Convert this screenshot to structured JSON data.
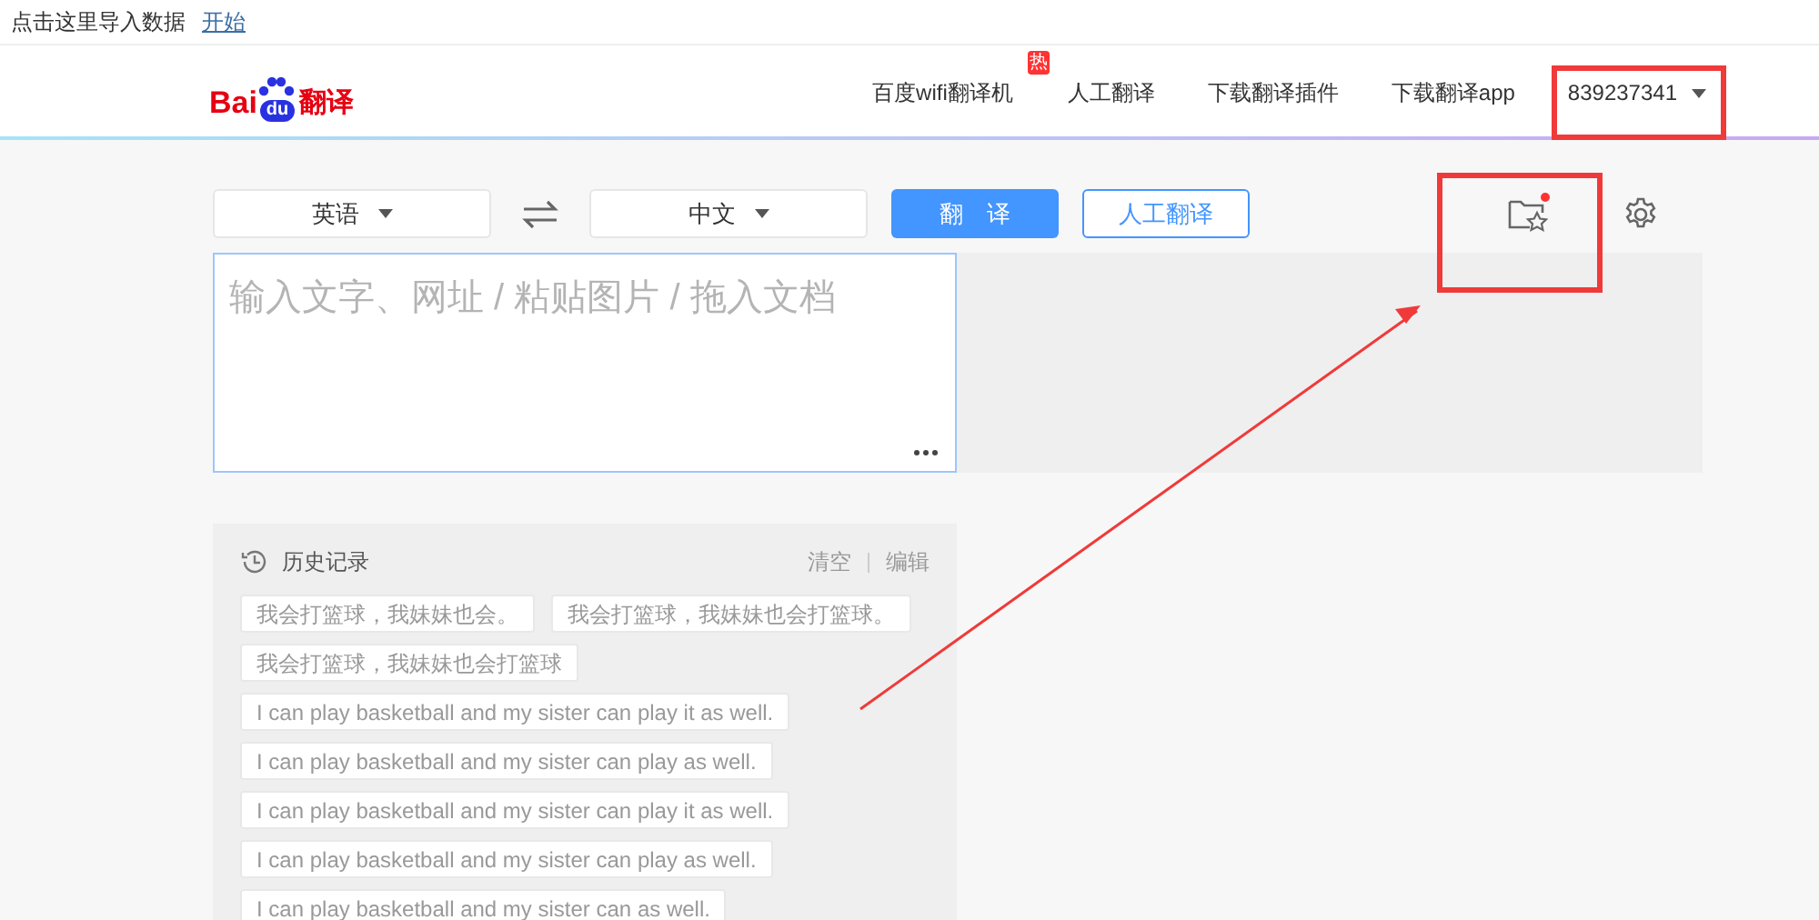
{
  "top_bar": {
    "prompt": "点击这里导入数据",
    "link": "开始"
  },
  "logo": {
    "brand_left": "Bai",
    "brand_paw": "du",
    "product": "翻译"
  },
  "nav": [
    {
      "label": "百度wifi翻译机",
      "badge": "热"
    },
    {
      "label": "人工翻译"
    },
    {
      "label": "下载翻译插件"
    },
    {
      "label": "下载翻译app"
    }
  ],
  "user": {
    "name": "839237341"
  },
  "source_language": "英语",
  "target_language": "中文",
  "translate_button": "翻　译",
  "human_button": "人工翻译",
  "favorites": {
    "unread": true
  },
  "input": {
    "placeholder": "输入文字、网址 / 粘贴图片 / 拖入文档"
  },
  "history": {
    "title": "历史记录",
    "clear": "清空",
    "edit": "编辑",
    "items": [
      "我会打篮球，我妹妹也会。",
      "我会打篮球，我妹妹也会打篮球。",
      "我会打篮球，我妹妹也会打篮球",
      "I can play basketball and my sister can play it as well.",
      "I can play basketball and my sister can play as well.",
      "I can play basketball and my sister can play it as well.",
      "I can play basketball and my sister can play as well.",
      "I can play basketball and my sister can as well."
    ]
  }
}
